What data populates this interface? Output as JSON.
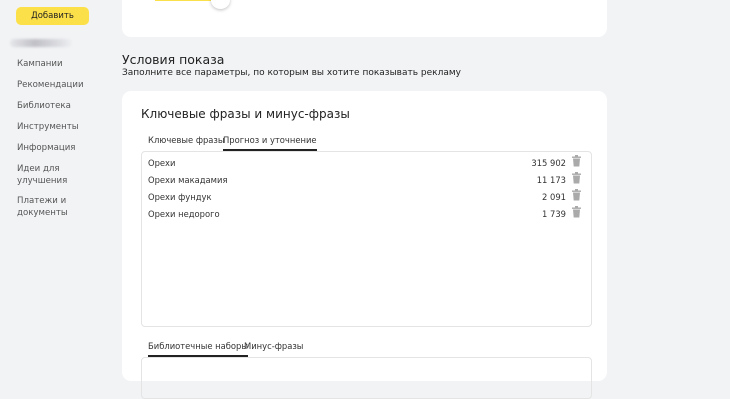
{
  "sidebar": {
    "add_button": "Добавить",
    "items": [
      {
        "label": "Кампании"
      },
      {
        "label": "Рекомендации"
      },
      {
        "label": "Библиотека"
      },
      {
        "label": "Инструменты"
      },
      {
        "label": "Информация"
      },
      {
        "label": "Идеи для улучшения"
      },
      {
        "label": "Платежи и документы"
      }
    ]
  },
  "section": {
    "title": "Условия показа",
    "subtitle": "Заполните все параметры, по которым вы хотите показывать рекламу"
  },
  "card": {
    "title": "Ключевые фразы и минус-фразы",
    "tabs": [
      {
        "label": "Ключевые фразы",
        "active": false
      },
      {
        "label": "Прогноз и уточнение",
        "active": true
      }
    ],
    "keywords": [
      {
        "phrase": "Орехи",
        "count": "315 902"
      },
      {
        "phrase": "Орехи макадамия",
        "count": "11 173"
      },
      {
        "phrase": "Орехи фундук",
        "count": "2 091"
      },
      {
        "phrase": "Орехи недорого",
        "count": "1 739"
      }
    ],
    "bottom_tabs": [
      {
        "label": "Библиотечные наборы",
        "active": true
      },
      {
        "label": "Минус-фразы",
        "active": false
      }
    ]
  },
  "colors": {
    "accent": "#fce04a",
    "background": "#f2f3f5",
    "panel": "#ffffff"
  }
}
